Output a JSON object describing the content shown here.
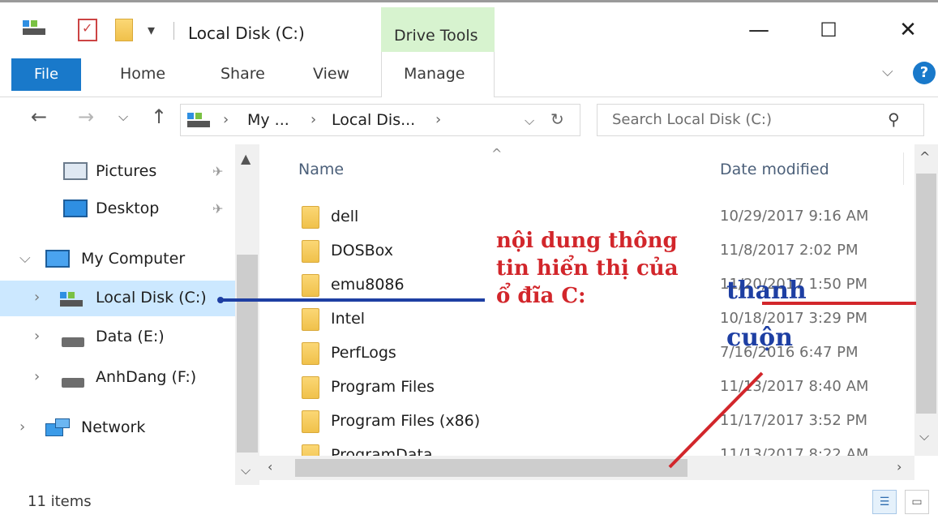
{
  "window": {
    "title": "Local Disk (C:)",
    "context_tab_group": "Drive Tools",
    "buttons": {
      "minimize": "—",
      "maximize": "☐",
      "close": "✕"
    }
  },
  "ribbon": {
    "tabs": [
      {
        "label": "File"
      },
      {
        "label": "Home"
      },
      {
        "label": "Share"
      },
      {
        "label": "View"
      },
      {
        "label": "Manage"
      }
    ],
    "help_label": "?"
  },
  "address_bar": {
    "segments": [
      "My ...",
      "Local Dis..."
    ],
    "search_placeholder": "Search Local Disk (C:)"
  },
  "navigation_pane": {
    "items": [
      {
        "label": "Pictures",
        "icon": "pictures-icon",
        "pinned": true
      },
      {
        "label": "Desktop",
        "icon": "desktop-icon",
        "pinned": true
      },
      {
        "label": "My Computer",
        "icon": "computer-icon",
        "expanded": true
      },
      {
        "label": "Local Disk (C:)",
        "icon": "drive-icon",
        "selected": true
      },
      {
        "label": "Data (E:)",
        "icon": "drive-icon"
      },
      {
        "label": "AnhDang (F:)",
        "icon": "drive-icon"
      },
      {
        "label": "Network",
        "icon": "network-icon"
      }
    ]
  },
  "file_list": {
    "columns": {
      "name": "Name",
      "date_modified": "Date modified"
    },
    "rows": [
      {
        "name": "dell",
        "date": "10/29/2017 9:16 AM"
      },
      {
        "name": "DOSBox",
        "date": "11/8/2017 2:02 PM"
      },
      {
        "name": "emu8086",
        "date": "11/20/2017 1:50 PM"
      },
      {
        "name": "Intel",
        "date": "10/18/2017 3:29 PM"
      },
      {
        "name": "PerfLogs",
        "date": "7/16/2016 6:47 PM"
      },
      {
        "name": "Program Files",
        "date": "11/13/2017 8:40 AM"
      },
      {
        "name": "Program Files (x86)",
        "date": "11/17/2017 3:52 PM"
      },
      {
        "name": "ProgramData",
        "date": "11/13/2017 8:22 AM"
      }
    ]
  },
  "status_bar": {
    "item_count": "11 items"
  },
  "annotations": {
    "content_label": "nội dung thông tin hiển thị của ổ đĩa C:",
    "scrollbar_label": "thanh cuộn",
    "colors": {
      "red": "#d2262b",
      "blue": "#1e3fa3"
    }
  }
}
